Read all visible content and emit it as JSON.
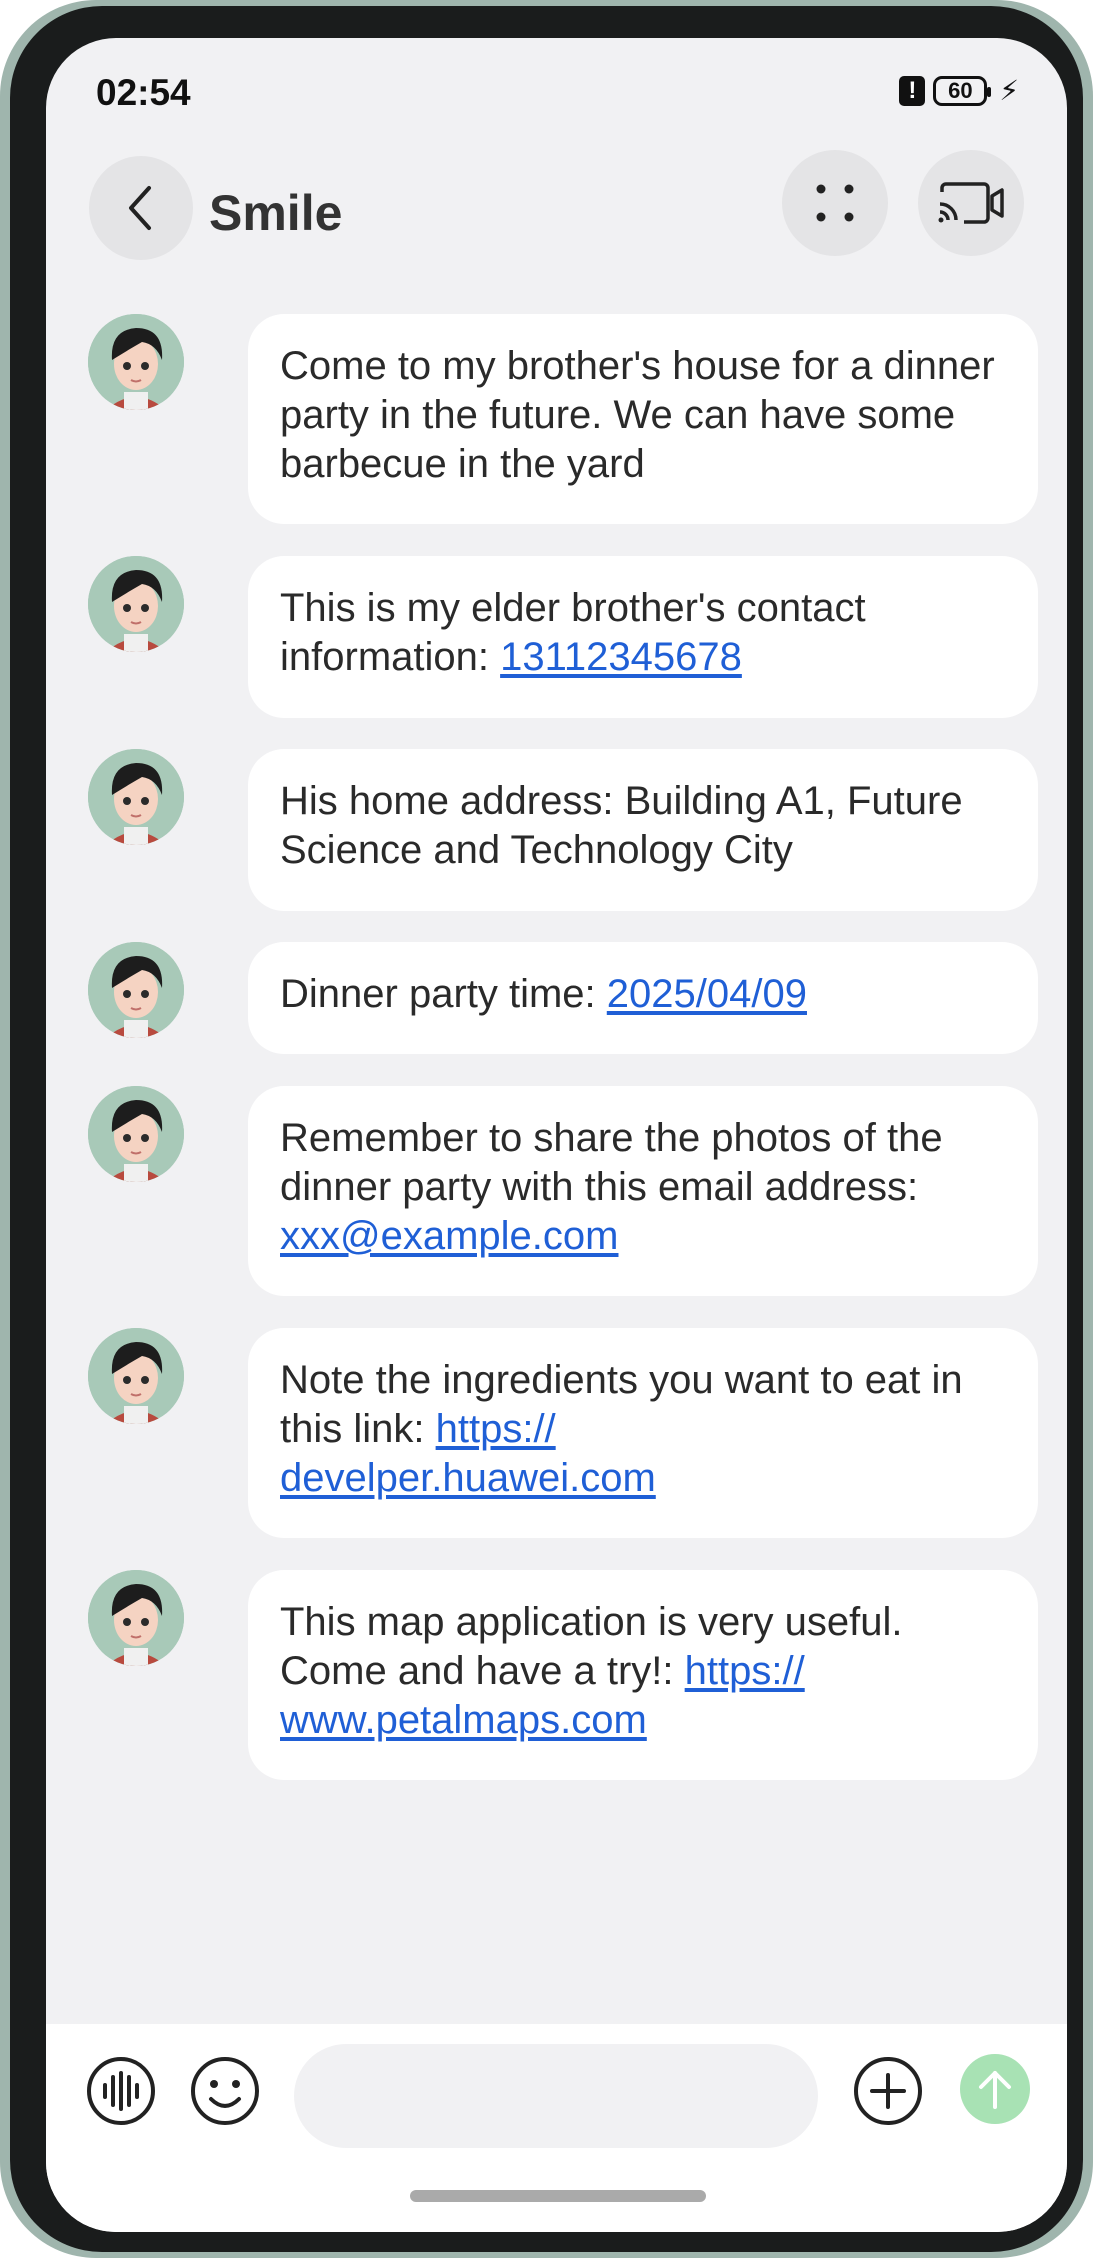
{
  "status_bar": {
    "time": "02:54",
    "battery": "60"
  },
  "header": {
    "title": "Smile"
  },
  "messages": [
    {
      "parts": [
        {
          "text": "Come to my brother's house for a dinner party in the future. We can have some barbecue in the yard",
          "link": false
        }
      ]
    },
    {
      "parts": [
        {
          "text": "This is my elder brother's contact information: ",
          "link": false
        },
        {
          "text": "13112345678",
          "link": true
        }
      ]
    },
    {
      "parts": [
        {
          "text": "His home address: Building A1, Future Science and Technology City",
          "link": false
        }
      ]
    },
    {
      "parts": [
        {
          "text": "Dinner party time: ",
          "link": false
        },
        {
          "text": "2025/04/09",
          "link": true
        }
      ]
    },
    {
      "parts": [
        {
          "text": "Remember to share the photos of the dinner party with this email address: ",
          "link": false
        },
        {
          "text": "xxx@example.com",
          "link": true
        }
      ]
    },
    {
      "parts": [
        {
          "text": "Note the ingredients you want to eat in this link: ",
          "link": false
        },
        {
          "text": "https://\ndevelper.huawei.com",
          "link": true
        }
      ]
    },
    {
      "parts": [
        {
          "text": "This map application is very useful. Come and have a try!: ",
          "link": false
        },
        {
          "text": "https://\nwww.petalmaps.com",
          "link": true
        }
      ]
    }
  ],
  "input": {
    "placeholder": ""
  },
  "colors": {
    "link": "#1f5fd6",
    "send": "#a8e2b4",
    "background": "#f1f1f3"
  }
}
